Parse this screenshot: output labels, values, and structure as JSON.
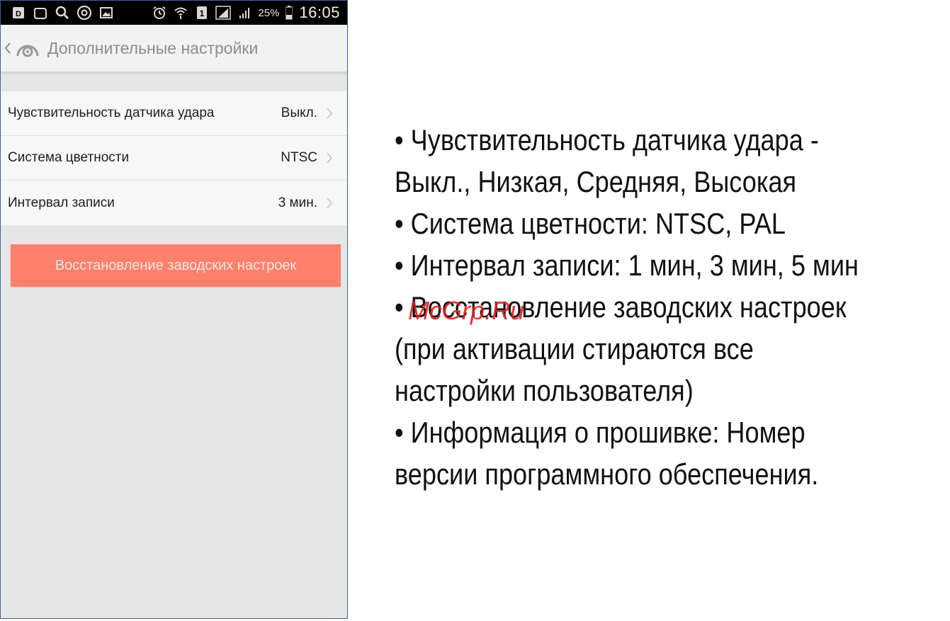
{
  "statusbar": {
    "battery_percent": "25%",
    "time": "16:05",
    "icons": [
      "screenshot-icon",
      "circle-icon",
      "search-icon",
      "at-icon",
      "image-icon",
      "alarm-icon",
      "wifi-icon",
      "sim-icon",
      "signal-icon",
      "signal-icon",
      "battery-icon"
    ]
  },
  "titlebar": {
    "title": "Дополнительные настройки"
  },
  "settings": [
    {
      "label": "Чувствительность датчика удара",
      "value": "Выкл."
    },
    {
      "label": "Система цветности",
      "value": "NTSC"
    },
    {
      "label": "Интервал записи",
      "value": "3 мин."
    }
  ],
  "reset_button": {
    "label": "Восстановление заводских настроек"
  },
  "description": {
    "lines": [
      "• Чувствительность датчика удара -",
      "Выкл., Низкая, Средняя, Высокая",
      "•  Система цветности: NTSC, PAL",
      "•  Интервал записи: 1 мин, 3 мин, 5 мин",
      "• Восстановление заводских настроек",
      "(при активации стираются все",
      "настройки пользователя)",
      "•  Информация о прошивке: Номер",
      "версии программного обеспечения."
    ]
  },
  "watermark": "McGrp.Ru",
  "colors": {
    "reset_button_bg": "#fc806b",
    "titlebar_bg": "#f2f2f2",
    "screen_bg": "#e6e6e6",
    "frame_border": "#3f5f9f"
  }
}
